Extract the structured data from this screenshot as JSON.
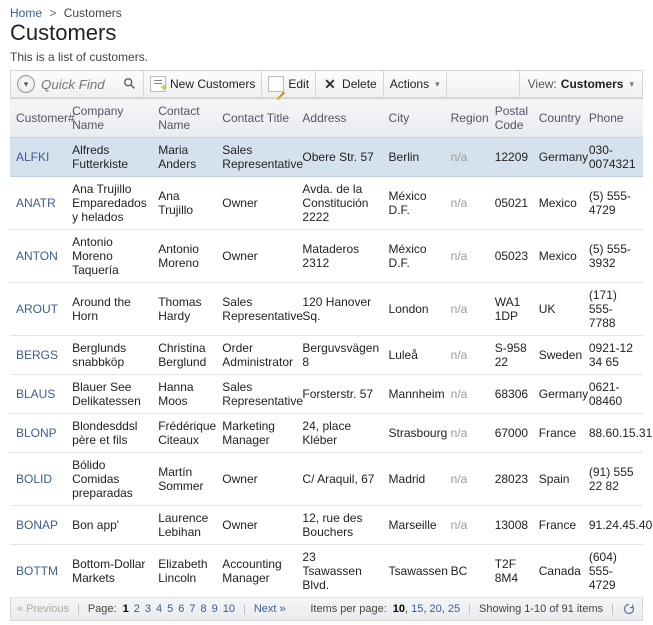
{
  "breadcrumb": {
    "home": "Home",
    "current": "Customers"
  },
  "page_title": "Customers",
  "subtitle": "This is a list of customers.",
  "toolbar": {
    "quick_find_placeholder": "Quick Find",
    "new": "New Customers",
    "edit": "Edit",
    "delete": "Delete",
    "actions": "Actions",
    "view_label": "View:",
    "view_name": "Customers"
  },
  "columns": {
    "id": "Customer#",
    "company": "Company Name",
    "contact_name": "Contact Name",
    "contact_title": "Contact Title",
    "address": "Address",
    "city": "City",
    "region": "Region",
    "postal": "Postal Code",
    "country": "Country",
    "phone": "Phone"
  },
  "rows": [
    {
      "id": "ALFKI",
      "company": "Alfreds Futterkiste",
      "contact_name": "Maria Anders",
      "contact_title": "Sales Representative",
      "address": "Obere Str. 57",
      "city": "Berlin",
      "region": "n/a",
      "postal": "12209",
      "country": "Germany",
      "phone": "030-0074321"
    },
    {
      "id": "ANATR",
      "company": "Ana Trujillo Emparedados y helados",
      "contact_name": "Ana Trujillo",
      "contact_title": "Owner",
      "address": "Avda. de la Constitución 2222",
      "city": "México D.F.",
      "region": "n/a",
      "postal": "05021",
      "country": "Mexico",
      "phone": "(5) 555-4729"
    },
    {
      "id": "ANTON",
      "company": "Antonio Moreno Taquería",
      "contact_name": "Antonio Moreno",
      "contact_title": "Owner",
      "address": "Mataderos 2312",
      "city": "México D.F.",
      "region": "n/a",
      "postal": "05023",
      "country": "Mexico",
      "phone": "(5) 555-3932"
    },
    {
      "id": "AROUT",
      "company": "Around the Horn",
      "contact_name": "Thomas Hardy",
      "contact_title": "Sales Representative",
      "address": "120 Hanover Sq.",
      "city": "London",
      "region": "n/a",
      "postal": "WA1 1DP",
      "country": "UK",
      "phone": "(171) 555-7788"
    },
    {
      "id": "BERGS",
      "company": "Berglunds snabbköp",
      "contact_name": "Christina Berglund",
      "contact_title": "Order Administrator",
      "address": "Berguvsvägen 8",
      "city": "Luleå",
      "region": "n/a",
      "postal": "S-958 22",
      "country": "Sweden",
      "phone": "0921-12 34 65"
    },
    {
      "id": "BLAUS",
      "company": "Blauer See Delikatessen",
      "contact_name": "Hanna Moos",
      "contact_title": "Sales Representative",
      "address": "Forsterstr. 57",
      "city": "Mannheim",
      "region": "n/a",
      "postal": "68306",
      "country": "Germany",
      "phone": "0621-08460"
    },
    {
      "id": "BLONP",
      "company": "Blondesddsl père et fils",
      "contact_name": "Frédérique Citeaux",
      "contact_title": "Marketing Manager",
      "address": "24, place Kléber",
      "city": "Strasbourg",
      "region": "n/a",
      "postal": "67000",
      "country": "France",
      "phone": "88.60.15.31"
    },
    {
      "id": "BOLID",
      "company": "Bólido Comidas preparadas",
      "contact_name": "Martín Sommer",
      "contact_title": "Owner",
      "address": "C/ Araquil, 67",
      "city": "Madrid",
      "region": "n/a",
      "postal": "28023",
      "country": "Spain",
      "phone": "(91) 555 22 82"
    },
    {
      "id": "BONAP",
      "company": "Bon app'",
      "contact_name": "Laurence Lebihan",
      "contact_title": "Owner",
      "address": "12, rue des Bouchers",
      "city": "Marseille",
      "region": "n/a",
      "postal": "13008",
      "country": "France",
      "phone": "91.24.45.40"
    },
    {
      "id": "BOTTM",
      "company": "Bottom-Dollar Markets",
      "contact_name": "Elizabeth Lincoln",
      "contact_title": "Accounting Manager",
      "address": "23 Tsawassen Blvd.",
      "city": "Tsawassen",
      "region": "BC",
      "postal": "T2F 8M4",
      "country": "Canada",
      "phone": "(604) 555-4729"
    }
  ],
  "selected_row_index": 0,
  "pager": {
    "previous": "« Previous",
    "page_label": "Page:",
    "pages": [
      "1",
      "2",
      "3",
      "4",
      "5",
      "6",
      "7",
      "8",
      "9",
      "10"
    ],
    "current_page": "1",
    "next": "Next »",
    "items_per_page_label": "Items per page:",
    "sizes": [
      "10",
      "15",
      "20",
      "25"
    ],
    "current_size": "10",
    "showing": "Showing 1-10 of 91 items"
  }
}
